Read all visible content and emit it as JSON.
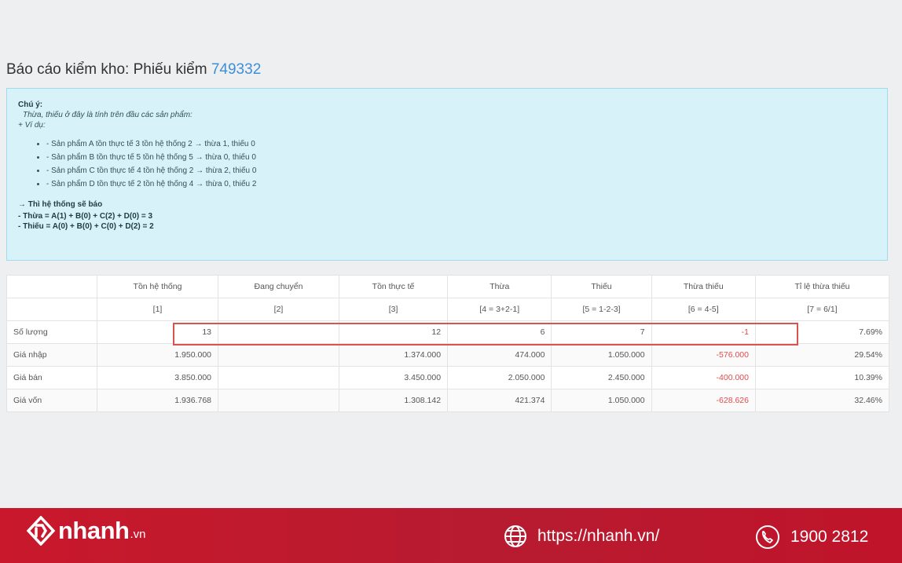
{
  "header": {
    "title": "Báo cáo kiểm kho: Phiếu kiểm",
    "code": "749332"
  },
  "note": {
    "heading": "Chú ý:",
    "line1": "Thừa, thiếu ở đây là tính trên đầu các sản phẩm:",
    "line2": "+ Ví dụ:",
    "examples": [
      "- Sản phẩm A tồn thực tế 3 tồn hệ thống 2 → thừa 1, thiếu 0",
      "- Sản phẩm B tồn thực tế 5 tồn hệ thống 5 → thừa 0, thiếu 0",
      "- Sản phẩm C tồn thực tế 4 tồn hệ thống 2 → thừa 2, thiếu 0",
      "- Sản phẩm D tồn thực tế 2 tồn hệ thống 4 → thừa 0, thiếu 2"
    ],
    "summary_title": "→ Thì hệ thống sẽ báo",
    "summary_surplus": "- Thừa = A(1) + B(0) + C(2) + D(0) = 3",
    "summary_shortage": "- Thiếu = A(0) + B(0) + C(0) + D(2) = 2"
  },
  "table": {
    "columns": [
      "Tồn hệ thống",
      "Đang chuyển",
      "Tồn thực tế",
      "Thừa",
      "Thiếu",
      "Thừa thiếu",
      "Tỉ lệ thừa thiếu"
    ],
    "formulas": [
      "[1]",
      "[2]",
      "[3]",
      "[4 = 3+2-1]",
      "[5 = 1-2-3]",
      "[6 = 4-5]",
      "[7 = 6/1]"
    ],
    "rows": [
      {
        "label": "Số lượng",
        "cells": [
          "13",
          "",
          "12",
          "6",
          "7",
          "-1",
          "7.69%"
        ]
      },
      {
        "label": "Giá nhập",
        "cells": [
          "1.950.000",
          "",
          "1.374.000",
          "474.000",
          "1.050.000",
          "-576.000",
          "29.54%"
        ]
      },
      {
        "label": "Giá bán",
        "cells": [
          "3.850.000",
          "",
          "3.450.000",
          "2.050.000",
          "2.450.000",
          "-400.000",
          "10.39%"
        ]
      },
      {
        "label": "Giá vốn",
        "cells": [
          "1.936.768",
          "",
          "1.308.142",
          "421.374",
          "1.050.000",
          "-628.626",
          "32.46%"
        ]
      }
    ]
  },
  "footer": {
    "brand": "nhanh",
    "brand_tld": ".vn",
    "url": "https://nhanh.vn/",
    "phone": "1900 2812",
    "globe_icon": "globe-icon",
    "phone_icon": "phone-icon"
  },
  "colors": {
    "link": "#3c8fd8",
    "negative": "#e34b4b",
    "footer_bg": "#c21a2e",
    "note_bg": "#d7f3f9"
  }
}
